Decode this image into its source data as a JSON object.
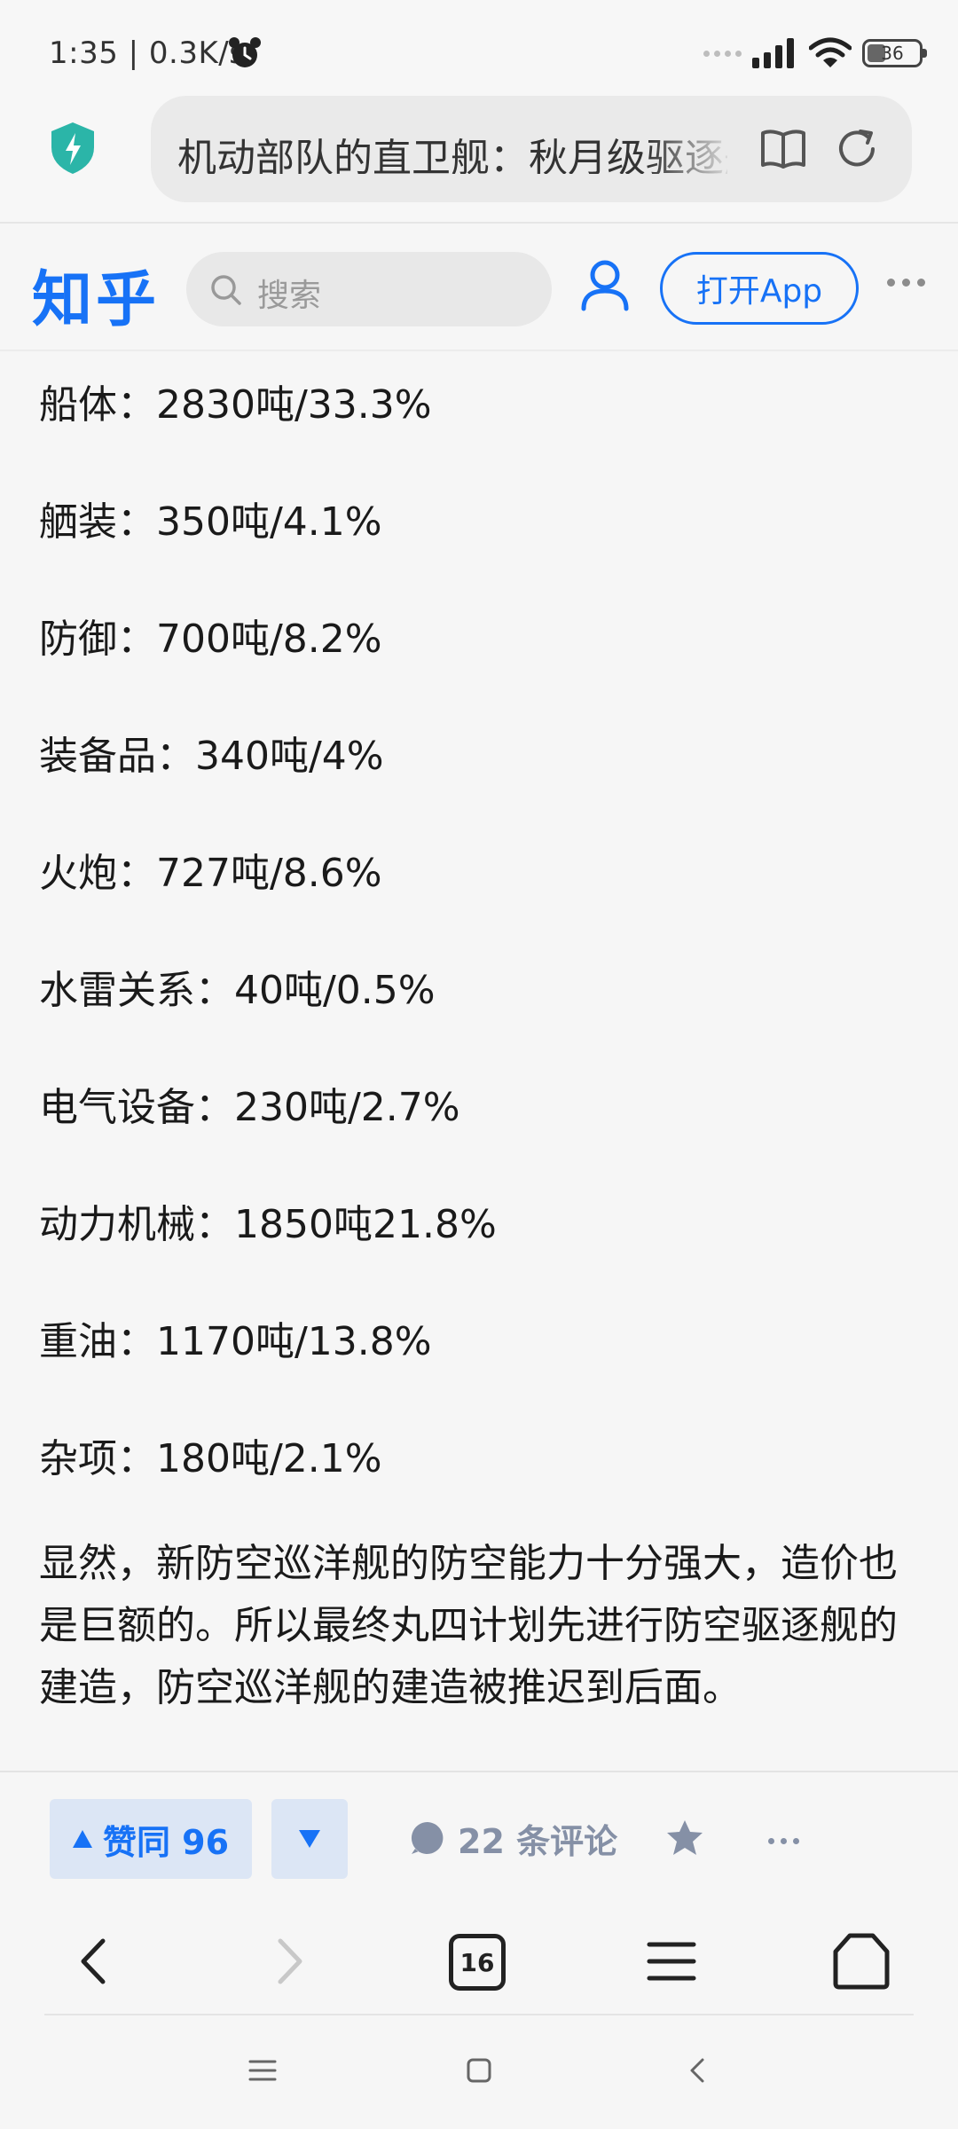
{
  "status_bar": {
    "time": "1:35 | 0.3K/s",
    "battery": "36"
  },
  "browser": {
    "url_title": "机动部队的直卫舰：秋月级驱逐舰",
    "icons": [
      "shield-icon",
      "reader-mode-icon",
      "reload-icon"
    ]
  },
  "zhihu_header": {
    "logo": "知乎",
    "search_placeholder": "搜索",
    "open_app": "打开App"
  },
  "article": {
    "stats": [
      "船体：2830吨/33.3%",
      "舾装：350吨/4.1%",
      "防御：700吨/8.2%",
      "装备品：340吨/4%",
      "火炮：727吨/8.6%",
      "水雷关系：40吨/0.5%",
      "电气设备：230吨/2.7%",
      "动力机械：1850吨21.8%",
      "重油：1170吨/13.8%",
      "杂项：180吨/2.1%"
    ],
    "paragraph": "显然，新防空巡洋舰的防空能力十分强大，造价也是巨额的。所以最终丸四计划先进行防空驱逐舰的建造，防空巡洋舰的建造被推迟到后面。"
  },
  "action_bar": {
    "vote_up": "赞同 96",
    "comments": "22 条评论"
  },
  "browser_nav": {
    "tab_count": "16"
  },
  "colors": {
    "brand": "#1772f6",
    "vote_bg": "#dce6f5",
    "muted": "#8590a6"
  }
}
